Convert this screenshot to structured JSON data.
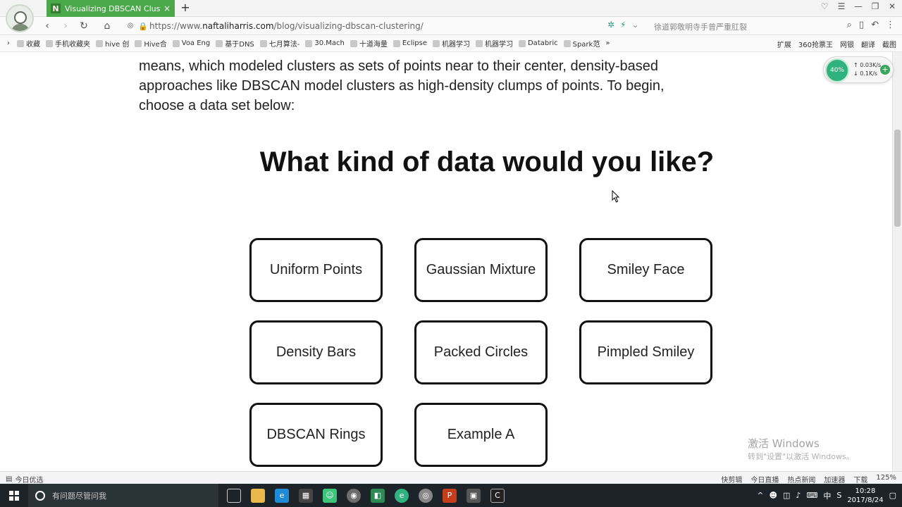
{
  "browser": {
    "tab_title": "Visualizing DBSCAN Clusteri",
    "tab_close": "×",
    "new_tab": "+",
    "url_scheme": "https://www.",
    "url_host": "naftaliharris.com",
    "url_path": "/blog/visualizing-dbscan-clustering/",
    "search_hint": "徐道郭敬明寺手曾严重肛裂",
    "window_buttons": [
      "♡",
      "☰",
      "—",
      "❐",
      "✕"
    ]
  },
  "bookmarks": {
    "items": [
      "收藏",
      "手机收藏夹",
      "hive 创",
      "Hive合",
      "Voa Eng",
      "基于DNS",
      "七月算法-",
      "30.Mach",
      "十道海量",
      "Eclipse",
      "机器学习",
      "机器学习",
      "Databric",
      "Spark范"
    ],
    "more": "»",
    "right_items": [
      "扩展",
      "360抢票王",
      "网银",
      "翻译",
      "截图"
    ]
  },
  "page": {
    "intro": "means, which modeled clusters as sets of points near to their center, density-based approaches like DBSCAN model clusters as high-density clumps of points. To begin, choose a data set below:",
    "heading": "What kind of data would you like?",
    "options": [
      "Uniform Points",
      "Gaussian Mixture",
      "Smiley Face",
      "Density Bars",
      "Packed Circles",
      "Pimpled Smiley",
      "DBSCAN Rings",
      "Example A"
    ]
  },
  "watermark": {
    "line1": "激活 Windows",
    "line2": "转到\"设置\"以激活 Windows。"
  },
  "speed_widget": {
    "percent": "40%",
    "up": "0.03K/s",
    "down": "0.1K/s",
    "plus": "+"
  },
  "statusbar": {
    "left": "今日优选",
    "right": [
      "快剪辑",
      "今日直播",
      "热点新闻",
      "加速器",
      "下载",
      "125%"
    ]
  },
  "taskbar": {
    "search_placeholder": "有问题尽管问我",
    "time": "10:28",
    "date": "2017/8/24",
    "ime": "中"
  }
}
